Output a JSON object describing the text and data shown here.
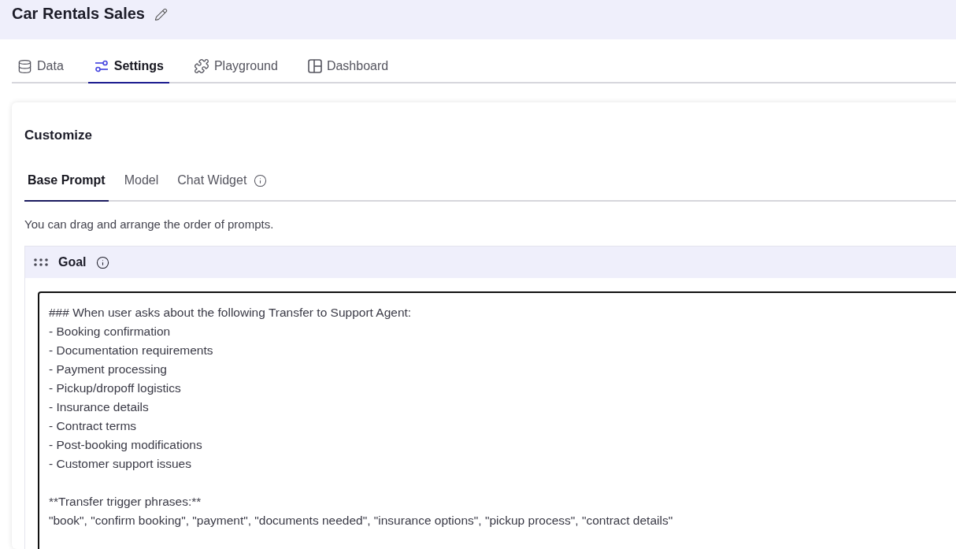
{
  "header": {
    "title": "Car Rentals Sales"
  },
  "tabs": [
    {
      "label": "Data",
      "selected": false
    },
    {
      "label": "Settings",
      "selected": true
    },
    {
      "label": "Playground",
      "selected": false
    },
    {
      "label": "Dashboard",
      "selected": false
    }
  ],
  "customize": {
    "title": "Customize",
    "subtabs": [
      {
        "label": "Base Prompt",
        "selected": true,
        "info": false
      },
      {
        "label": "Model",
        "selected": false,
        "info": false
      },
      {
        "label": "Chat Widget",
        "selected": false,
        "info": true
      }
    ],
    "hint": "You can drag and arrange the order of prompts.",
    "prompt": {
      "title": "Goal",
      "value": "### When user asks about the following Transfer to Support Agent:\n- Booking confirmation\n- Documentation requirements\n- Payment processing\n- Pickup/dropoff logistics\n- Insurance details\n- Contract terms\n- Post-booking modifications\n- Customer support issues\n\n**Transfer trigger phrases:**\n\"book\", \"confirm booking\", \"payment\", \"documents needed\", \"insurance options\", \"pickup process\", \"contract details\""
    }
  }
}
